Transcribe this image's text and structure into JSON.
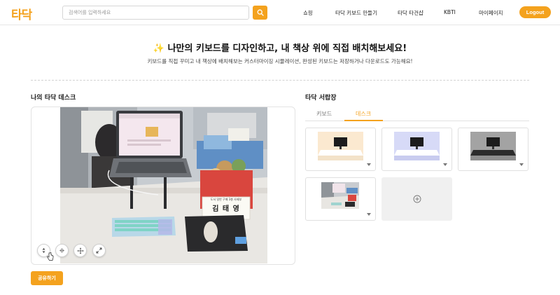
{
  "header": {
    "logo": "타닥",
    "search_placeholder": "검색어를 입력하세요",
    "nav": [
      "쇼핑",
      "타닥 키보드 만들기",
      "타닥 타건샵",
      "KBTI",
      "마이페이지"
    ],
    "logout": "Logout"
  },
  "hero": {
    "title": "✨ 나만의 키보드를 디자인하고, 내 책상 위에 직접 배치해보세요!",
    "subtitle": "키보드를 직접 꾸미고 내 책상에 배치해보는 커스터마이징 시뮬레이션, 완성된 키보드는 저장하거나 다운로드도 가능해요!"
  },
  "desk": {
    "title": "나의 타닥 데스크",
    "nameplate_line1": "도서 일반 구매 3층 사제부",
    "nameplate_name": "김 태 영",
    "controls": [
      "resize-vertical-icon",
      "flip-horizontal-icon",
      "move-icon",
      "expand-icon"
    ],
    "share": "공유하기"
  },
  "drawer": {
    "title": "타닥 서랍장",
    "tabs": [
      "키보드",
      "데스크"
    ],
    "active_tab": "데스크",
    "cards": [
      {
        "name": "cream-desk",
        "bg": "#fbe9d0",
        "table": "#ffffff"
      },
      {
        "name": "lavender-desk",
        "bg": "#d7daf7",
        "table": "#ffffff"
      },
      {
        "name": "gray-desk",
        "bg": "#a3a3a3",
        "table": "#2c2c2c"
      },
      {
        "name": "photo-desk",
        "bg": "#c9ccd0",
        "table": "#e8e6e2"
      }
    ],
    "add_icon": "plus-circle-icon"
  },
  "colors": {
    "accent": "#f4a21e"
  }
}
